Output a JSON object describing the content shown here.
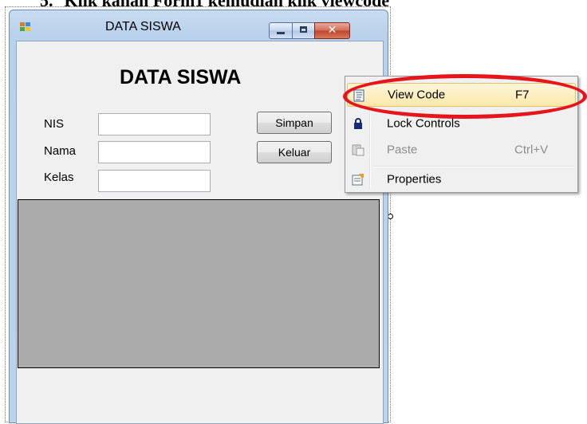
{
  "document": {
    "list_number": "5.",
    "text": "Klik kanan Form1 kemudian klik viewcode"
  },
  "window": {
    "title": "DATA SISWA",
    "close_glyph": "✕"
  },
  "form": {
    "heading": "DATA SISWA",
    "fields": [
      {
        "label": "NIS",
        "value": ""
      },
      {
        "label": "Nama",
        "value": ""
      },
      {
        "label": "Kelas",
        "value": ""
      }
    ],
    "buttons": {
      "save": "Simpan",
      "exit": "Keluar"
    }
  },
  "context_menu": {
    "items": [
      {
        "label": "View Code",
        "shortcut": "F7",
        "icon": "code-icon",
        "highlighted": true,
        "enabled": true
      },
      {
        "label": "Lock Controls",
        "shortcut": "",
        "icon": "lock-icon",
        "highlighted": false,
        "enabled": true
      },
      {
        "label": "Paste",
        "shortcut": "Ctrl+V",
        "icon": "paste-icon",
        "highlighted": false,
        "enabled": false
      },
      {
        "label": "Properties",
        "shortcut": "",
        "icon": "properties-icon",
        "highlighted": false,
        "enabled": true
      }
    ]
  },
  "colors": {
    "highlight_ellipse": "#e8141b",
    "grid_background": "#ababab",
    "menu_highlight": "#fbe8a9"
  }
}
